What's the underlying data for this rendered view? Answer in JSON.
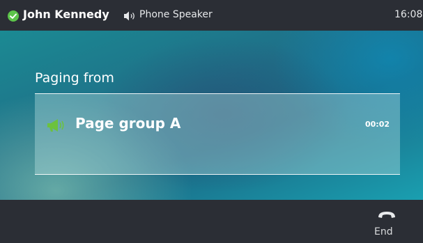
{
  "status_bar": {
    "status_icon": "check-circle-icon",
    "status_color": "#5cc44a",
    "user_name": "John Kennedy",
    "audio_icon": "speaker-volume-icon",
    "audio_mode": "Phone Speaker",
    "clock": "16:08"
  },
  "main": {
    "heading": "Paging from",
    "page_card": {
      "icon": "megaphone-icon",
      "icon_color": "#6cc23e",
      "group_name": "Page group A",
      "duration": "00:02"
    }
  },
  "softkeys": [
    {
      "label": "End",
      "icon": "handset-hangup-icon"
    }
  ],
  "colors": {
    "bar_background": "#2b2e35",
    "accent_teal": "#1a8fa0"
  }
}
